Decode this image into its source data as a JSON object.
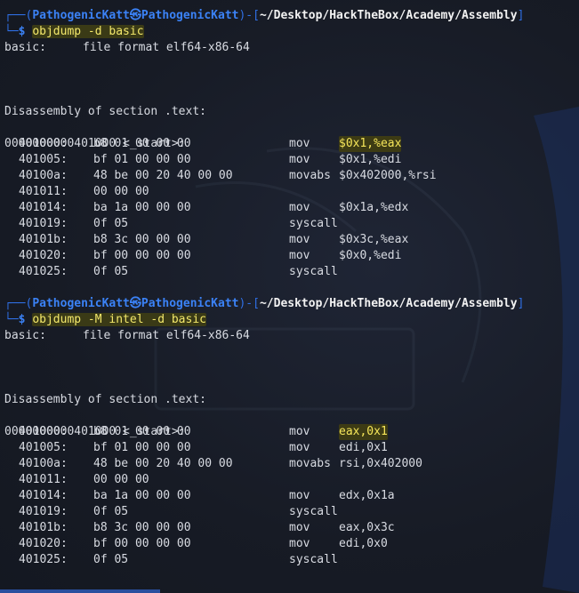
{
  "prompt1": {
    "user": "PathogenicKatt",
    "skull": "㉿",
    "host": "PathogenicKatt",
    "path": "~/Desktop/HackTheBox/Academy/Assembly",
    "command": "objdump -d basic"
  },
  "prompt2": {
    "user": "PathogenicKatt",
    "skull": "㉿",
    "host": "PathogenicKatt",
    "path": "~/Desktop/HackTheBox/Academy/Assembly",
    "command": "objdump -M intel -d basic"
  },
  "frame": {
    "top_left": "┌──(",
    "top_right": ")-[",
    "top_end": "]",
    "bottom": "└─",
    "sign": "$"
  },
  "out1": {
    "format_label": "basic:",
    "format_value": "file format elf64-x86-64",
    "section": "Disassembly of section .text:",
    "symbol": "0000000000401000 <_start>:",
    "rows": [
      {
        "addr": "401000:",
        "bytes": "b8 01 00 00 00",
        "mn": "mov",
        "op": "$0x1,%eax"
      },
      {
        "addr": "401005:",
        "bytes": "bf 01 00 00 00",
        "mn": "mov",
        "op": "$0x1,%edi"
      },
      {
        "addr": "40100a:",
        "bytes": "48 be 00 20 40 00 00",
        "mn": "movabs",
        "op": "$0x402000,%rsi"
      },
      {
        "addr": "401011:",
        "bytes": "00 00 00",
        "mn": "",
        "op": ""
      },
      {
        "addr": "401014:",
        "bytes": "ba 1a 00 00 00",
        "mn": "mov",
        "op": "$0x1a,%edx"
      },
      {
        "addr": "401019:",
        "bytes": "0f 05",
        "mn": "syscall",
        "op": ""
      },
      {
        "addr": "40101b:",
        "bytes": "b8 3c 00 00 00",
        "mn": "mov",
        "op": "$0x3c,%eax"
      },
      {
        "addr": "401020:",
        "bytes": "bf 00 00 00 00",
        "mn": "mov",
        "op": "$0x0,%edi"
      },
      {
        "addr": "401025:",
        "bytes": "0f 05",
        "mn": "syscall",
        "op": ""
      }
    ]
  },
  "out2": {
    "format_label": "basic:",
    "format_value": "file format elf64-x86-64",
    "section": "Disassembly of section .text:",
    "symbol": "0000000000401000 <_start>:",
    "rows": [
      {
        "addr": "401000:",
        "bytes": "b8 01 00 00 00",
        "mn": "mov",
        "op": "eax,0x1"
      },
      {
        "addr": "401005:",
        "bytes": "bf 01 00 00 00",
        "mn": "mov",
        "op": "edi,0x1"
      },
      {
        "addr": "40100a:",
        "bytes": "48 be 00 20 40 00 00",
        "mn": "movabs",
        "op": "rsi,0x402000"
      },
      {
        "addr": "401011:",
        "bytes": "00 00 00",
        "mn": "",
        "op": ""
      },
      {
        "addr": "401014:",
        "bytes": "ba 1a 00 00 00",
        "mn": "mov",
        "op": "edx,0x1a"
      },
      {
        "addr": "401019:",
        "bytes": "0f 05",
        "mn": "syscall",
        "op": ""
      },
      {
        "addr": "40101b:",
        "bytes": "b8 3c 00 00 00",
        "mn": "mov",
        "op": "eax,0x3c"
      },
      {
        "addr": "401020:",
        "bytes": "bf 00 00 00 00",
        "mn": "mov",
        "op": "edi,0x0"
      },
      {
        "addr": "401025:",
        "bytes": "0f 05",
        "mn": "syscall",
        "op": ""
      }
    ]
  },
  "colors": {
    "background": "#181d27",
    "prompt_blue": "#3b82f6",
    "command_yellow": "#f3e86b",
    "highlight_bg": "#3d3b14"
  }
}
